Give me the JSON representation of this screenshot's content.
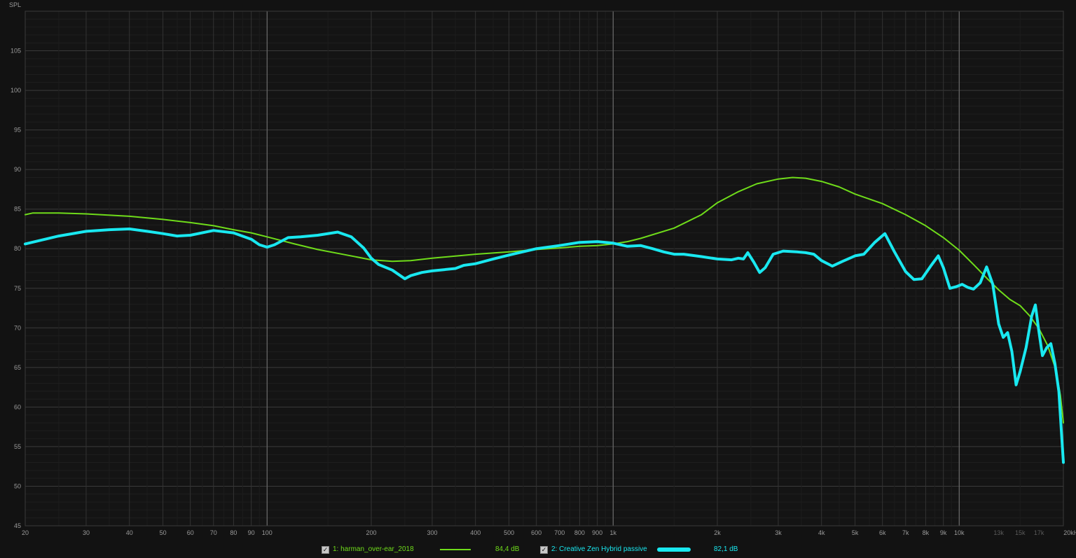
{
  "chart_data": {
    "type": "line",
    "ylabel": "SPL",
    "x_scale": "log",
    "xlim": [
      20,
      20000
    ],
    "ylim": [
      45,
      110
    ],
    "yticks": [
      45,
      50,
      55,
      60,
      65,
      70,
      75,
      80,
      85,
      90,
      95,
      100,
      105
    ],
    "xticks": [
      {
        "v": 20,
        "label": "20"
      },
      {
        "v": 30,
        "label": "30"
      },
      {
        "v": 40,
        "label": "40"
      },
      {
        "v": 50,
        "label": "50"
      },
      {
        "v": 60,
        "label": "60"
      },
      {
        "v": 70,
        "label": "70"
      },
      {
        "v": 80,
        "label": "80"
      },
      {
        "v": 90,
        "label": "90"
      },
      {
        "v": 100,
        "label": "100"
      },
      {
        "v": 200,
        "label": "200"
      },
      {
        "v": 300,
        "label": "300"
      },
      {
        "v": 400,
        "label": "400"
      },
      {
        "v": 500,
        "label": "500"
      },
      {
        "v": 600,
        "label": "600"
      },
      {
        "v": 700,
        "label": "700"
      },
      {
        "v": 800,
        "label": "800"
      },
      {
        "v": 900,
        "label": "900"
      },
      {
        "v": 1000,
        "label": "1k"
      },
      {
        "v": 2000,
        "label": "2k"
      },
      {
        "v": 3000,
        "label": "3k"
      },
      {
        "v": 4000,
        "label": "4k"
      },
      {
        "v": 5000,
        "label": "5k"
      },
      {
        "v": 6000,
        "label": "6k"
      },
      {
        "v": 7000,
        "label": "7k"
      },
      {
        "v": 8000,
        "label": "8k"
      },
      {
        "v": 9000,
        "label": "9k"
      },
      {
        "v": 10000,
        "label": "10k"
      },
      {
        "v": 13000,
        "label": "13k"
      },
      {
        "v": 15000,
        "label": "15k"
      },
      {
        "v": 17000,
        "label": "17k"
      },
      {
        "v": 20000,
        "label": "20kHz"
      }
    ],
    "grid": true,
    "background": "#121212",
    "series": [
      {
        "name": "1: harman_over-ear_2018",
        "color": "#6fdc1a",
        "legend_value": "84,4 dB",
        "points": [
          [
            20,
            84.3
          ],
          [
            21,
            84.5
          ],
          [
            25,
            84.5
          ],
          [
            30,
            84.4
          ],
          [
            40,
            84.1
          ],
          [
            50,
            83.7
          ],
          [
            60,
            83.3
          ],
          [
            70,
            82.9
          ],
          [
            80,
            82.4
          ],
          [
            90,
            82.0
          ],
          [
            100,
            81.5
          ],
          [
            120,
            80.6
          ],
          [
            140,
            79.9
          ],
          [
            170,
            79.2
          ],
          [
            200,
            78.6
          ],
          [
            230,
            78.4
          ],
          [
            260,
            78.5
          ],
          [
            300,
            78.8
          ],
          [
            400,
            79.3
          ],
          [
            500,
            79.6
          ],
          [
            600,
            79.9
          ],
          [
            700,
            80.1
          ],
          [
            800,
            80.3
          ],
          [
            900,
            80.4
          ],
          [
            1000,
            80.6
          ],
          [
            1100,
            80.9
          ],
          [
            1200,
            81.3
          ],
          [
            1500,
            82.6
          ],
          [
            1800,
            84.3
          ],
          [
            2000,
            85.8
          ],
          [
            2300,
            87.2
          ],
          [
            2600,
            88.2
          ],
          [
            3000,
            88.8
          ],
          [
            3300,
            89.0
          ],
          [
            3600,
            88.9
          ],
          [
            4000,
            88.5
          ],
          [
            4500,
            87.8
          ],
          [
            5000,
            86.9
          ],
          [
            6000,
            85.7
          ],
          [
            7000,
            84.3
          ],
          [
            8000,
            82.9
          ],
          [
            9000,
            81.4
          ],
          [
            10000,
            79.8
          ],
          [
            11000,
            78.0
          ],
          [
            12000,
            76.3
          ],
          [
            13000,
            74.8
          ],
          [
            14000,
            73.6
          ],
          [
            15000,
            72.8
          ],
          [
            16000,
            71.5
          ],
          [
            17000,
            69.9
          ],
          [
            18000,
            67.8
          ],
          [
            19000,
            64.8
          ],
          [
            19600,
            61.5
          ],
          [
            20000,
            58.0
          ]
        ]
      },
      {
        "name": "2: Creative Zen Hybrid passive",
        "color": "#19e8f0",
        "legend_value": "82,1 dB",
        "points": [
          [
            20,
            80.6
          ],
          [
            25,
            81.6
          ],
          [
            30,
            82.2
          ],
          [
            35,
            82.4
          ],
          [
            40,
            82.5
          ],
          [
            45,
            82.2
          ],
          [
            50,
            81.9
          ],
          [
            55,
            81.6
          ],
          [
            60,
            81.7
          ],
          [
            70,
            82.3
          ],
          [
            80,
            82.0
          ],
          [
            90,
            81.2
          ],
          [
            95,
            80.5
          ],
          [
            100,
            80.2
          ],
          [
            105,
            80.5
          ],
          [
            115,
            81.4
          ],
          [
            125,
            81.5
          ],
          [
            140,
            81.7
          ],
          [
            160,
            82.1
          ],
          [
            175,
            81.5
          ],
          [
            190,
            80.1
          ],
          [
            200,
            78.8
          ],
          [
            210,
            78.0
          ],
          [
            230,
            77.3
          ],
          [
            250,
            76.2
          ],
          [
            260,
            76.6
          ],
          [
            280,
            77.0
          ],
          [
            300,
            77.2
          ],
          [
            350,
            77.5
          ],
          [
            370,
            77.9
          ],
          [
            400,
            78.1
          ],
          [
            450,
            78.7
          ],
          [
            500,
            79.2
          ],
          [
            600,
            80.0
          ],
          [
            700,
            80.4
          ],
          [
            800,
            80.8
          ],
          [
            900,
            80.9
          ],
          [
            1000,
            80.7
          ],
          [
            1100,
            80.3
          ],
          [
            1200,
            80.4
          ],
          [
            1300,
            80.0
          ],
          [
            1400,
            79.6
          ],
          [
            1500,
            79.3
          ],
          [
            1600,
            79.3
          ],
          [
            1800,
            79.0
          ],
          [
            2000,
            78.7
          ],
          [
            2200,
            78.6
          ],
          [
            2300,
            78.8
          ],
          [
            2380,
            78.7
          ],
          [
            2450,
            79.5
          ],
          [
            2550,
            78.3
          ],
          [
            2650,
            77.0
          ],
          [
            2750,
            77.6
          ],
          [
            2900,
            79.3
          ],
          [
            3100,
            79.7
          ],
          [
            3400,
            79.6
          ],
          [
            3600,
            79.5
          ],
          [
            3800,
            79.3
          ],
          [
            4000,
            78.5
          ],
          [
            4300,
            77.8
          ],
          [
            4600,
            78.4
          ],
          [
            5000,
            79.1
          ],
          [
            5300,
            79.3
          ],
          [
            5700,
            80.8
          ],
          [
            6100,
            81.9
          ],
          [
            6500,
            79.6
          ],
          [
            7000,
            77.1
          ],
          [
            7400,
            76.1
          ],
          [
            7800,
            76.2
          ],
          [
            8300,
            77.9
          ],
          [
            8700,
            79.1
          ],
          [
            9000,
            77.6
          ],
          [
            9400,
            75.0
          ],
          [
            9800,
            75.2
          ],
          [
            10200,
            75.5
          ],
          [
            10600,
            75.1
          ],
          [
            11000,
            74.9
          ],
          [
            11500,
            75.7
          ],
          [
            12000,
            77.7
          ],
          [
            12500,
            75.5
          ],
          [
            13000,
            70.5
          ],
          [
            13400,
            68.8
          ],
          [
            13800,
            69.4
          ],
          [
            14200,
            67.0
          ],
          [
            14600,
            62.8
          ],
          [
            15000,
            64.5
          ],
          [
            15600,
            67.5
          ],
          [
            16200,
            71.5
          ],
          [
            16600,
            72.9
          ],
          [
            17000,
            69.5
          ],
          [
            17400,
            66.5
          ],
          [
            17900,
            67.5
          ],
          [
            18400,
            68.0
          ],
          [
            18900,
            65.5
          ],
          [
            19400,
            62.0
          ],
          [
            19800,
            56.0
          ],
          [
            20000,
            53.0
          ]
        ]
      }
    ]
  },
  "legend": [
    {
      "check": "✓",
      "label": "1: harman_over-ear_2018",
      "value": "84,4 dB"
    },
    {
      "check": "✓",
      "label": "2: Creative Zen Hybrid passive",
      "value": "82,1 dB"
    }
  ]
}
